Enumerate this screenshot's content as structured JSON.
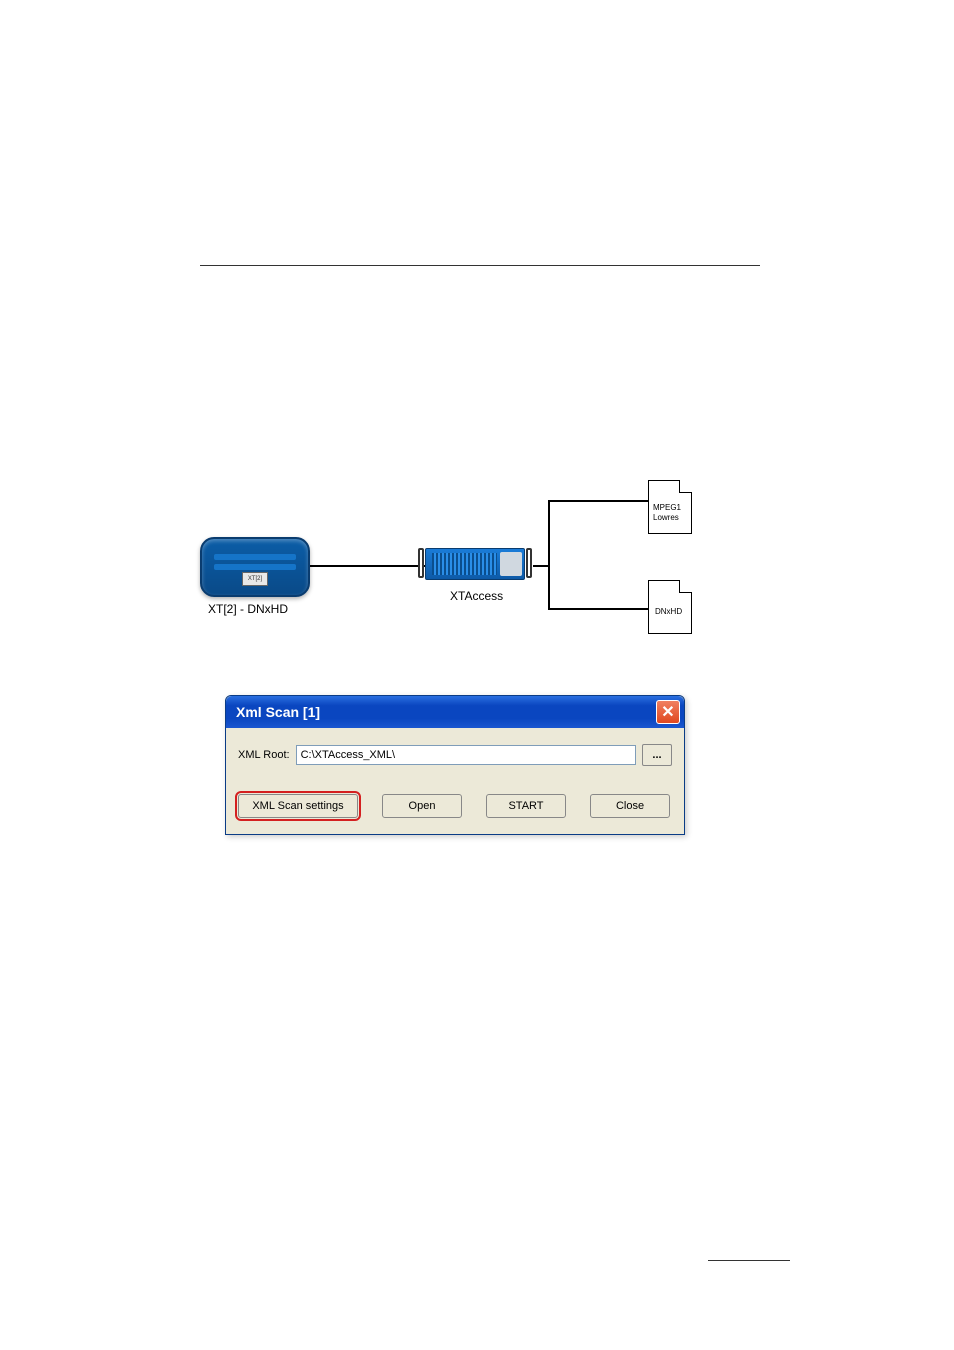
{
  "diagram": {
    "xt2_chip": "XT[2]",
    "xt2_caption": "XT[2]  - DNxHD",
    "xta_caption": "XTAccess",
    "file_mpeg_line1": "MPEG1",
    "file_mpeg_line2": "Lowres",
    "file_dnxhd": "DNxHD"
  },
  "dialog": {
    "title": "Xml Scan [1]",
    "close_glyph": "✕",
    "xml_root_label": "XML Root:",
    "xml_root_value": "C:\\XTAccess_XML\\",
    "browse_label": "...",
    "scan_settings_label": "XML Scan settings",
    "open_label": "Open",
    "start_label": "START",
    "close_label": "Close"
  }
}
